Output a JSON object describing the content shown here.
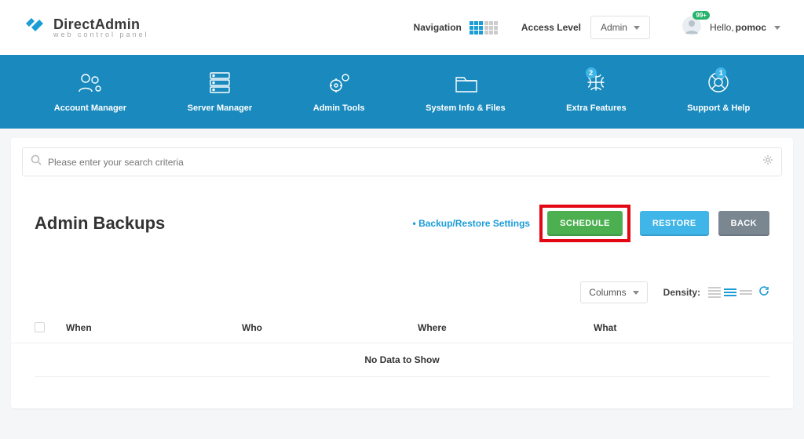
{
  "brand": {
    "title": "DirectAdmin",
    "subtitle": "web control panel"
  },
  "topbar": {
    "navigation_label": "Navigation",
    "access_level_label": "Access Level",
    "access_level_value": "Admin",
    "hello_prefix": "Hello,",
    "username": "pomoc",
    "avatar_badge": "99+"
  },
  "bluebar": {
    "items": [
      {
        "label": "Account Manager"
      },
      {
        "label": "Server Manager"
      },
      {
        "label": "Admin Tools"
      },
      {
        "label": "System Info & Files"
      },
      {
        "label": "Extra Features",
        "badge": "2"
      },
      {
        "label": "Support & Help",
        "badge": "1"
      }
    ]
  },
  "search": {
    "placeholder": "Please enter your search criteria"
  },
  "page": {
    "title": "Admin Backups",
    "settings_link": "Backup/Restore Settings",
    "buttons": {
      "schedule": "SCHEDULE",
      "restore": "RESTORE",
      "back": "BACK"
    }
  },
  "tools": {
    "columns_label": "Columns",
    "density_label": "Density:"
  },
  "table": {
    "headers": {
      "when": "When",
      "who": "Who",
      "where": "Where",
      "what": "What"
    },
    "empty": "No Data to Show"
  }
}
